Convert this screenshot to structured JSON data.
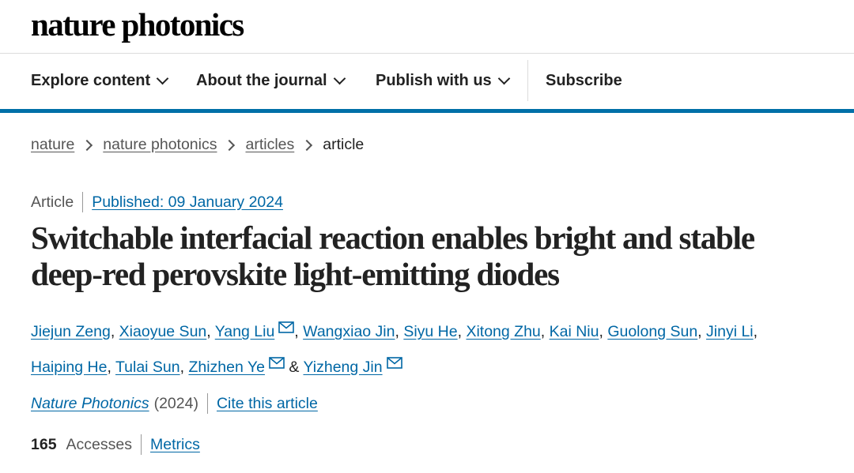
{
  "brand": {
    "name": "nature photonics"
  },
  "nav": {
    "items": [
      {
        "label": "Explore content"
      },
      {
        "label": "About the journal"
      },
      {
        "label": "Publish with us"
      }
    ],
    "subscribe": "Subscribe"
  },
  "breadcrumb": [
    "nature",
    "nature photonics",
    "articles",
    "article"
  ],
  "article": {
    "type": "Article",
    "published": "Published: 09 January 2024",
    "title": "Switchable interfacial reaction enables bright and stable deep-red perovskite light-emitting diodes",
    "authors": [
      {
        "name": "Jiejun Zeng",
        "mail": false
      },
      {
        "name": "Xiaoyue Sun",
        "mail": false
      },
      {
        "name": "Yang Liu",
        "mail": true
      },
      {
        "name": "Wangxiao Jin",
        "mail": false
      },
      {
        "name": "Siyu He",
        "mail": false
      },
      {
        "name": "Xitong Zhu",
        "mail": false
      },
      {
        "name": "Kai Niu",
        "mail": false
      },
      {
        "name": "Guolong Sun",
        "mail": false
      },
      {
        "name": "Jinyi Li",
        "mail": false
      },
      {
        "name": "Haiping He",
        "mail": false
      },
      {
        "name": "Tulai Sun",
        "mail": false
      },
      {
        "name": "Zhizhen Ye",
        "mail": true
      },
      {
        "name": "Yizheng Jin",
        "mail": true
      }
    ],
    "journal": "Nature Photonics",
    "year": "(2024)",
    "cite": "Cite this article",
    "accesses_count": "165",
    "accesses_label": "Accesses",
    "metrics": "Metrics"
  },
  "colors": {
    "link": "#0067a5",
    "accent_bar": "#0070a8"
  },
  "icons": {
    "mail": "envelope-icon",
    "chevron": "chevron-down-icon",
    "breadcrumb_sep": "chevron-right-icon"
  }
}
